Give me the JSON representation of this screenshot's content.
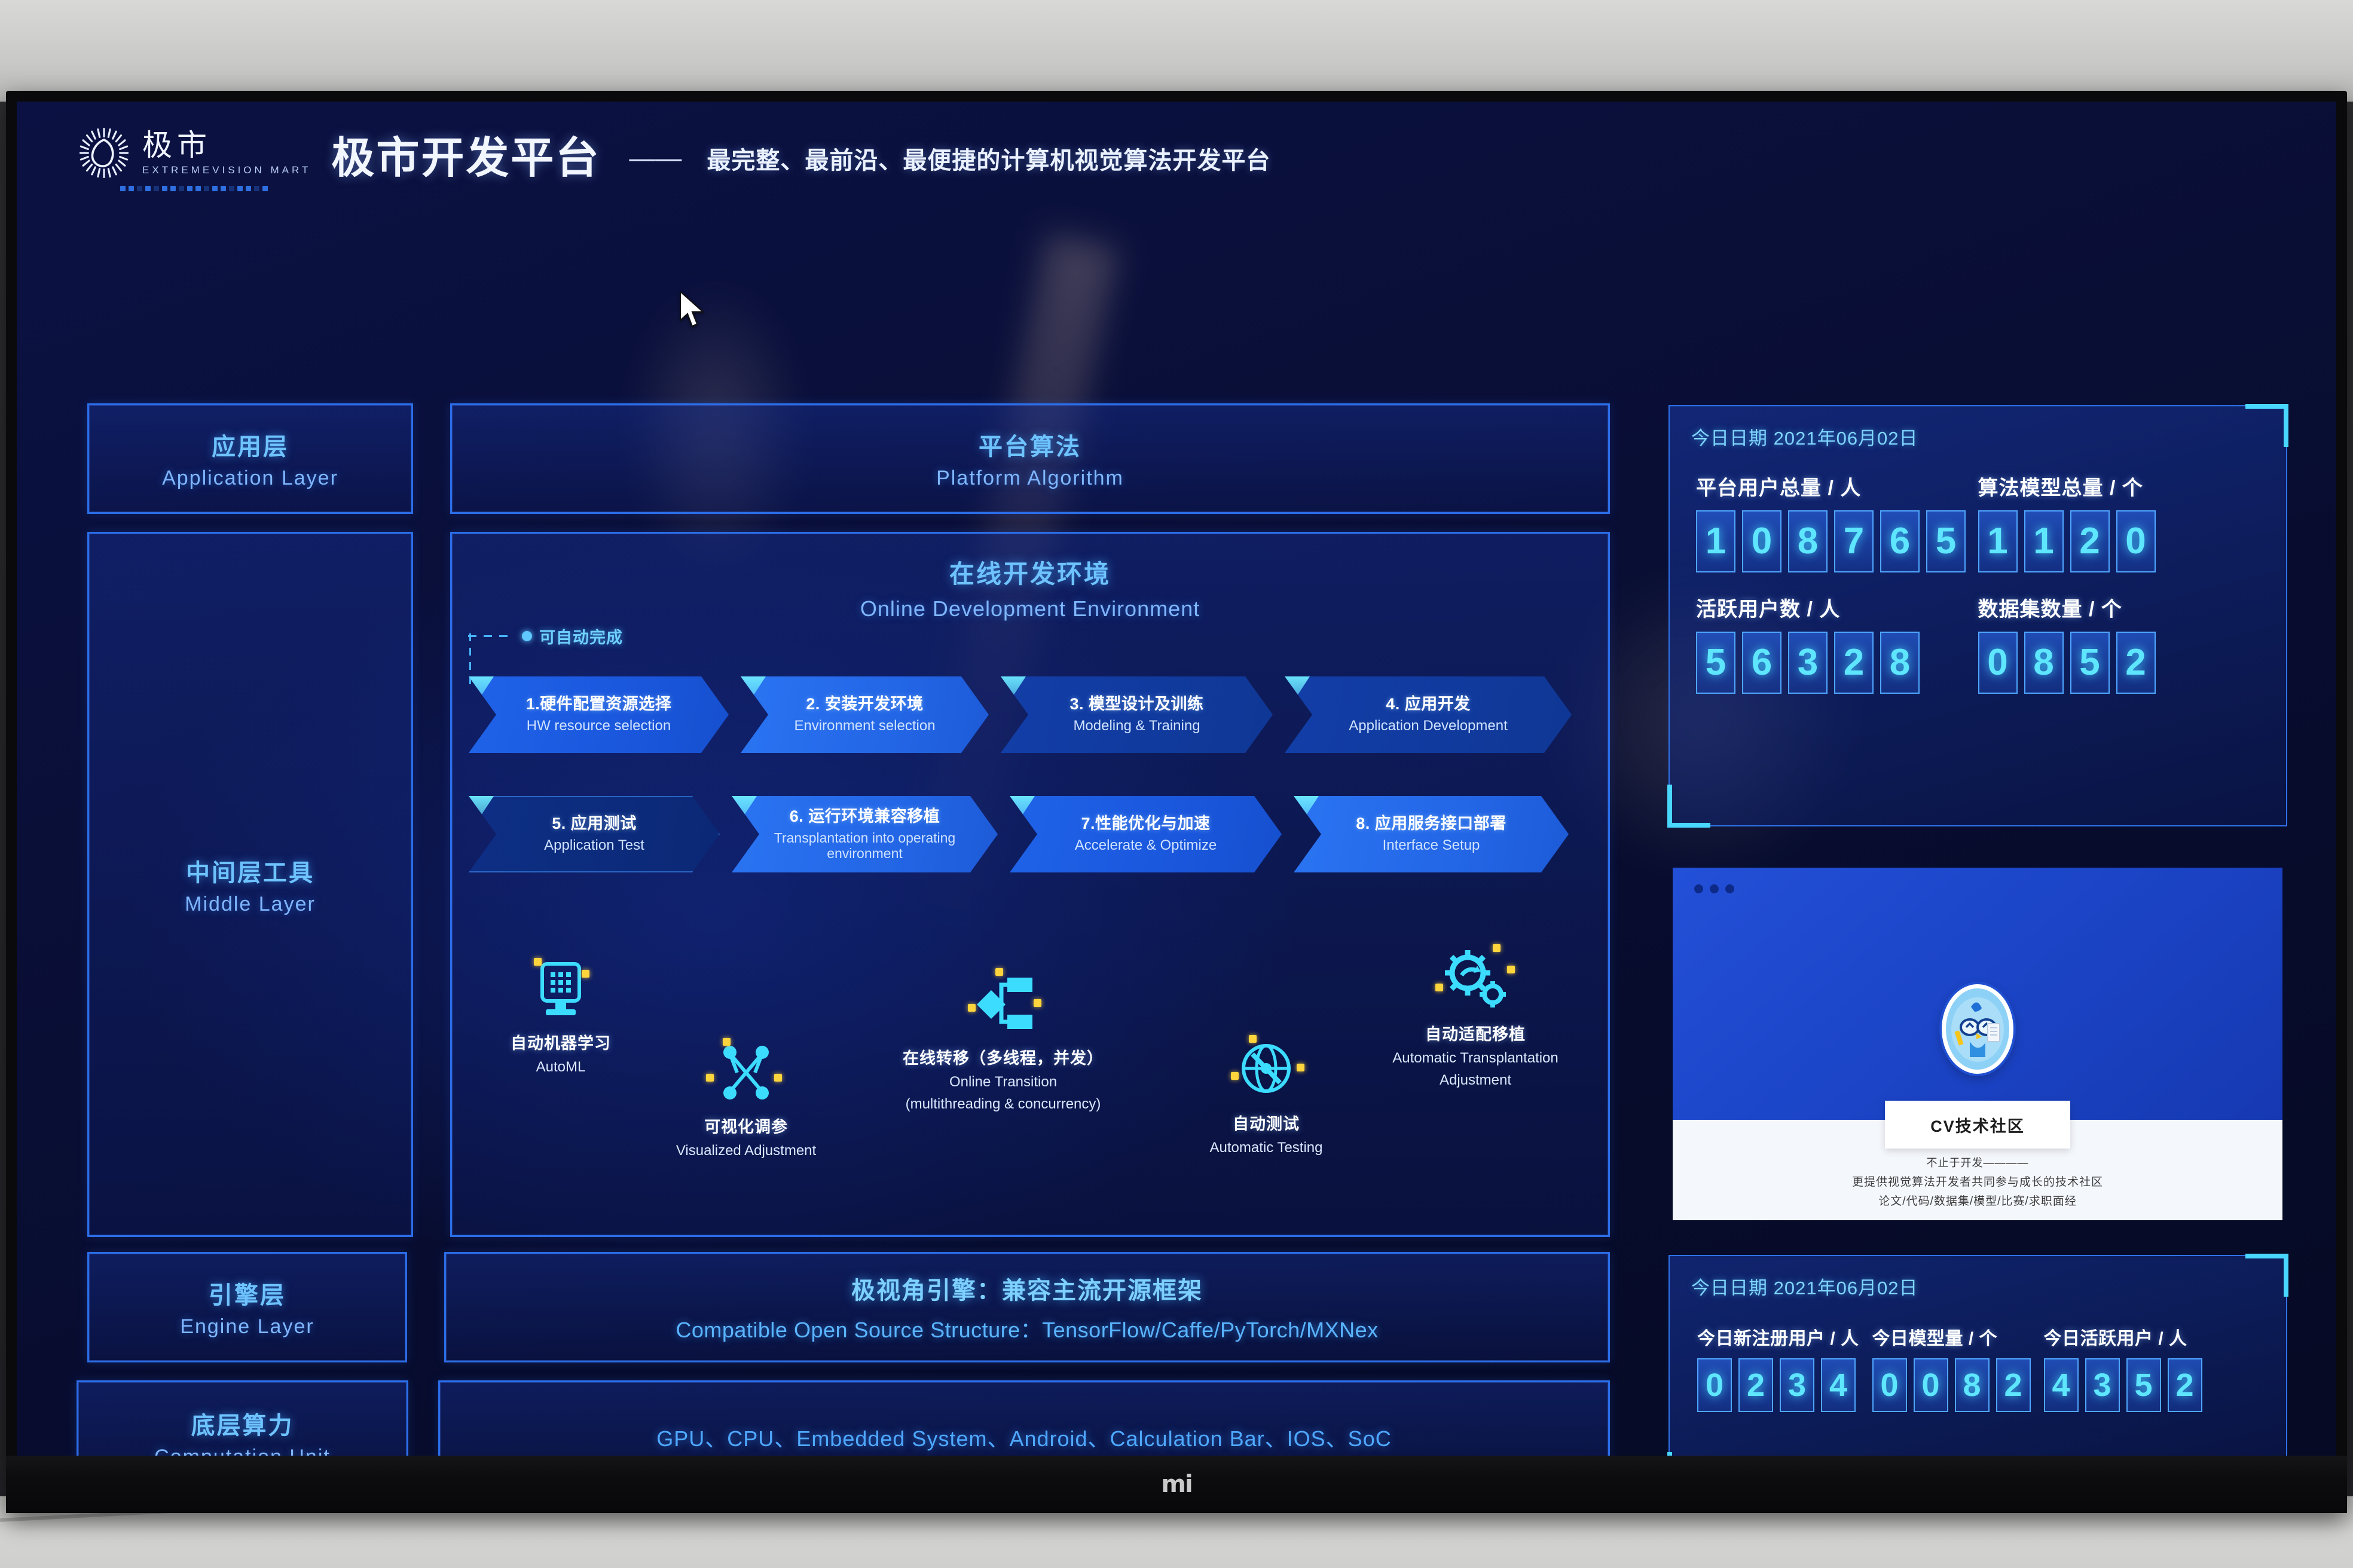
{
  "room": {
    "tv_brand_logo": "mi"
  },
  "header": {
    "logo_cn": "极市",
    "logo_en": "EXTREMEVISION MART",
    "title": "极市开发平台",
    "dash": "——",
    "subtitle": "最完整、最前沿、最便捷的计算机视觉算法开发平台"
  },
  "layers": [
    {
      "cn": "应用层",
      "en": "Application Layer"
    },
    {
      "cn": "中间层工具",
      "en": "Middle Layer"
    },
    {
      "cn": "引擎层",
      "en": "Engine Layer"
    },
    {
      "cn": "底层算力",
      "en": "Computation  Unit"
    }
  ],
  "platform": {
    "cn": "平台算法",
    "en": "Platform Algorithm"
  },
  "online": {
    "cn": "在线开发环境",
    "en": "Online Development Environment",
    "auto_note": "可自动完成",
    "steps": [
      {
        "cn": "1.硬件配置资源选择",
        "en": "HW resource selection"
      },
      {
        "cn": "2. 安装开发环境",
        "en": "Environment selection"
      },
      {
        "cn": "3. 模型设计及训练",
        "en": "Modeling & Training"
      },
      {
        "cn": "4. 应用开发",
        "en": "Application Development"
      },
      {
        "cn": "5. 应用测试",
        "en": "Application Test"
      },
      {
        "cn": "6. 运行环境兼容移植",
        "en": "Transplantation into operating environment"
      },
      {
        "cn": "7.性能优化与加速",
        "en": "Accelerate & Optimize"
      },
      {
        "cn": "8. 应用服务接口部署",
        "en": "Interface Setup"
      }
    ],
    "features": [
      {
        "cn": "自动机器学习",
        "en": "AutoML",
        "icon": "device-grid-icon"
      },
      {
        "cn": "可视化调参",
        "en": "Visualized Adjustment",
        "icon": "network-nodes-icon"
      },
      {
        "cn": "在线转移（多线程，并发）",
        "en": "Online Transition",
        "en2": "(multithreading & concurrency)",
        "icon": "transfer-nodes-icon"
      },
      {
        "cn": "自动测试",
        "en": "Automatic Testing",
        "icon": "globe-test-icon"
      },
      {
        "cn": "自动适配移植",
        "en": "Automatic Transplantation",
        "en2": "Adjustment",
        "icon": "gears-icon"
      }
    ]
  },
  "engine": {
    "cn": "极视角引擎：兼容主流开源框架",
    "en": "Compatible Open Source Structure：TensorFlow/Caffe/PyTorch/MXNex"
  },
  "compute": {
    "line": "GPU、CPU、Embedded System、Android、Calculation Bar、IOS、SoC"
  },
  "stats_panel": {
    "date": "今日日期 2021年06月02日",
    "items": [
      {
        "label": "平台用户总量 / 人",
        "digits": [
          "1",
          "0",
          "8",
          "7",
          "6",
          "5"
        ]
      },
      {
        "label": "算法模型总量 / 个",
        "digits": [
          "1",
          "1",
          "2",
          "0"
        ]
      },
      {
        "label": "活跃用户数 / 人",
        "digits": [
          "5",
          "6",
          "3",
          "2",
          "8"
        ]
      },
      {
        "label": "数据集数量 / 个",
        "digits": [
          "0",
          "8",
          "5",
          "2"
        ]
      }
    ]
  },
  "cv_card": {
    "title": "CV技术社区",
    "line1": "不止于开发————",
    "line2": "更提供视觉算法开发者共同参与成长的技术社区",
    "line3": "论文/代码/数据集/模型/比赛/求职面经"
  },
  "today_panel": {
    "date": "今日日期 2021年06月02日",
    "items": [
      {
        "label": "今日新注册用户 / 人",
        "digits": [
          "0",
          "2",
          "3",
          "4"
        ]
      },
      {
        "label": "今日模型量 / 个",
        "digits": [
          "0",
          "0",
          "8",
          "2"
        ]
      },
      {
        "label": "今日活跃用户 / 人",
        "digits": [
          "4",
          "3",
          "5",
          "2"
        ]
      }
    ]
  },
  "colors": {
    "accent_cyan": "#49d7ff",
    "accent_blue": "#2b6de8",
    "digit_cyan": "#5fe6ff",
    "dot_yellow": "#ffd53d",
    "bg_deep": "#0a0f38"
  }
}
